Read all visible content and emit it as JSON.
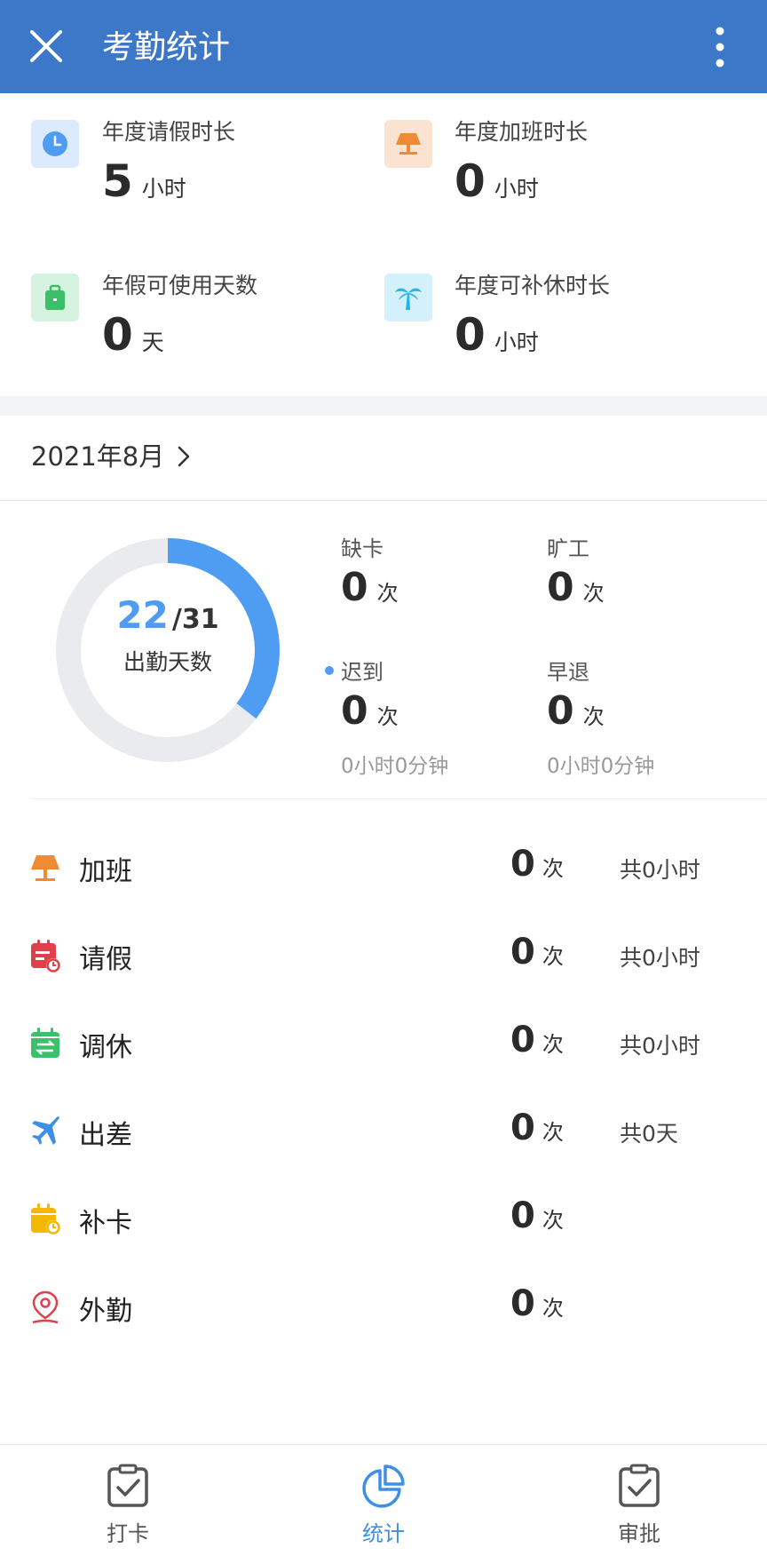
{
  "header": {
    "title": "考勤统计",
    "close_icon": "close-icon",
    "more_icon": "more-vertical-icon",
    "background": "#3d78c8"
  },
  "summary": [
    {
      "label": "年度请假时长",
      "value": "5",
      "unit": "小时",
      "icon": "clock-icon",
      "icon_bg": "#dbeafc",
      "icon_color": "#4f9df3"
    },
    {
      "label": "年度加班时长",
      "value": "0",
      "unit": "小时",
      "icon": "lamp-icon",
      "icon_bg": "#fbe3d2",
      "icon_color": "#ef8a35"
    },
    {
      "label": "年假可使用天数",
      "value": "0",
      "unit": "天",
      "icon": "suitcase-icon",
      "icon_bg": "#d6f3df",
      "icon_color": "#3cbf6b"
    },
    {
      "label": "年度可补休时长",
      "value": "0",
      "unit": "小时",
      "icon": "palm-tree-icon",
      "icon_bg": "#d4f0fb",
      "icon_color": "#27b4e6"
    }
  ],
  "month": {
    "label": "2021年8月"
  },
  "attendance": {
    "days": "22",
    "total": "/31",
    "label": "出勤天数",
    "ratio": 0.3548,
    "accent": "#4f9df3",
    "track": "#e9ebee"
  },
  "stats": [
    {
      "label": "缺卡",
      "value": "0",
      "unit": "次"
    },
    {
      "label": "旷工",
      "value": "0",
      "unit": "次"
    },
    {
      "label": "迟到",
      "value": "0",
      "unit": "次",
      "sub": "0小时0分钟"
    },
    {
      "label": "早退",
      "value": "0",
      "unit": "次",
      "sub": "0小时0分钟"
    }
  ],
  "records": [
    {
      "name": "加班",
      "count": "0",
      "unit": "次",
      "total": "共0小时",
      "icon": "lamp-icon",
      "color": "#ef8a35"
    },
    {
      "name": "请假",
      "count": "0",
      "unit": "次",
      "total": "共0小时",
      "icon": "leave-calendar-icon",
      "color": "#e0404a"
    },
    {
      "name": "调休",
      "count": "0",
      "unit": "次",
      "total": "共0小时",
      "icon": "swap-calendar-icon",
      "color": "#3cbf6b"
    },
    {
      "name": "出差",
      "count": "0",
      "unit": "次",
      "total": "共0天",
      "icon": "airplane-icon",
      "color": "#3f8fe6"
    },
    {
      "name": "补卡",
      "count": "0",
      "unit": "次",
      "total": "",
      "icon": "calendar-clock-icon",
      "color": "#f5b800"
    },
    {
      "name": "外勤",
      "count": "0",
      "unit": "次",
      "total": "",
      "icon": "location-pin-icon",
      "color": "#e0404a"
    }
  ],
  "tabs": [
    {
      "label": "打卡",
      "icon": "clipboard-check-icon",
      "active": false
    },
    {
      "label": "统计",
      "icon": "pie-chart-icon",
      "active": true
    },
    {
      "label": "审批",
      "icon": "clipboard-check-icon",
      "active": false
    }
  ]
}
